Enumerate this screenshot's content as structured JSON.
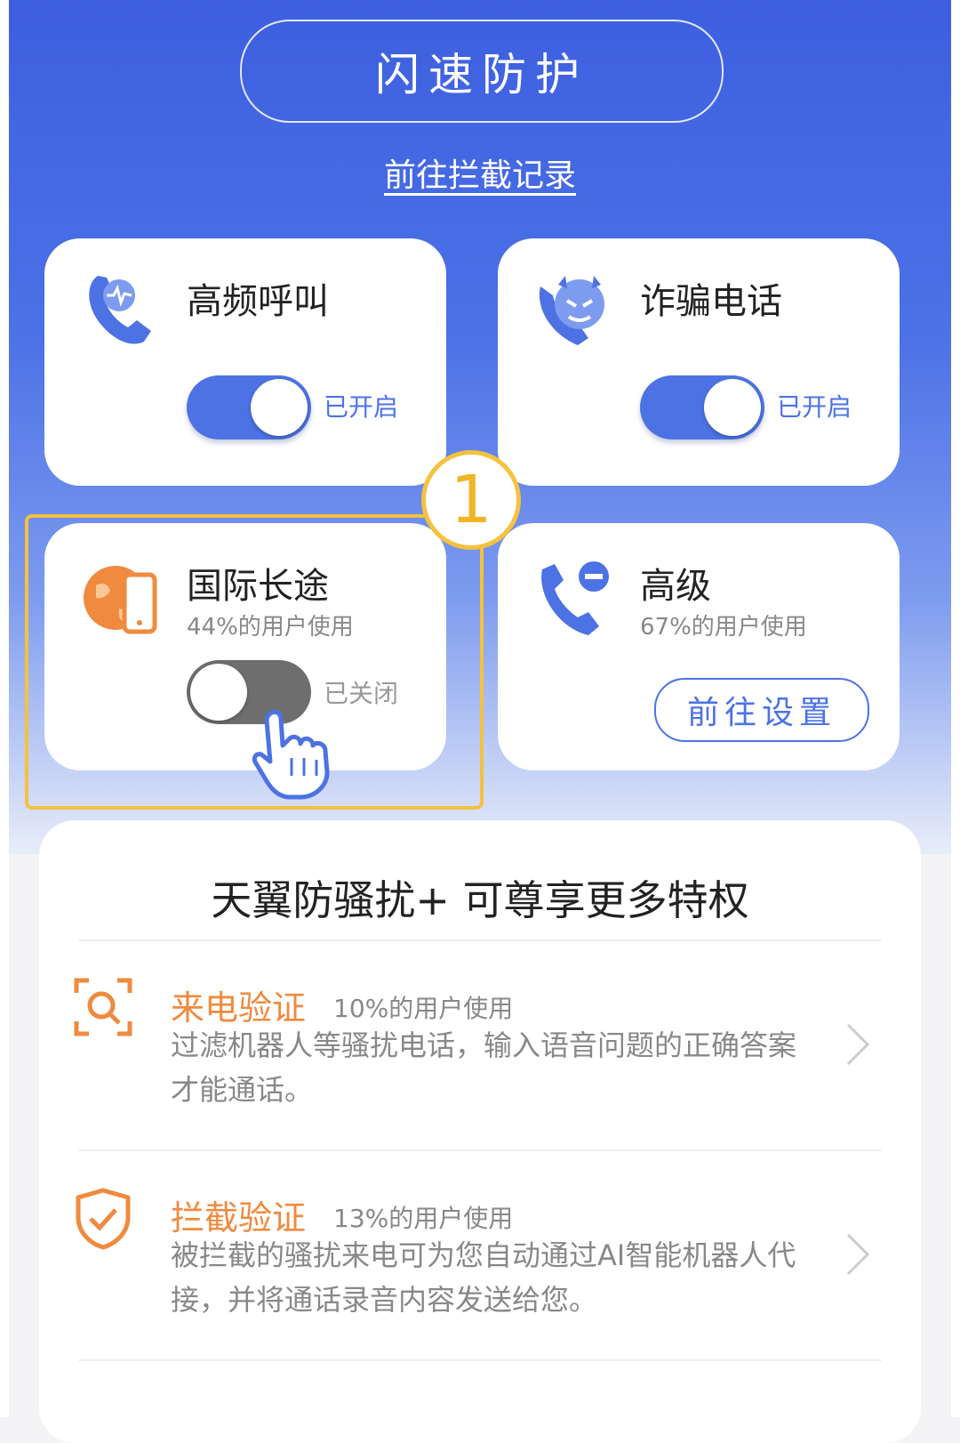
{
  "top": {
    "protect_button": "闪速防护",
    "record_link": "前往拦截记录"
  },
  "cards": [
    {
      "title": "高频呼叫",
      "state": "已开启",
      "enabled": true,
      "icon": "phone-heartbeat-icon"
    },
    {
      "title": "诈骗电话",
      "state": "已开启",
      "enabled": true,
      "icon": "devil-phone-icon"
    },
    {
      "title": "国际长途",
      "subtitle": "44%的用户使用",
      "state": "已关闭",
      "enabled": false,
      "icon": "globe-phone-icon"
    },
    {
      "title": "高级",
      "subtitle": "67%的用户使用",
      "button": "前往设置",
      "icon": "phone-minus-icon"
    }
  ],
  "step_badge": "1",
  "premium": {
    "title": "天翼防骚扰+ 可尊享更多特权",
    "features": [
      {
        "title": "来电验证",
        "usage": "10%的用户使用",
        "desc": "过滤机器人等骚扰电话，输入语音问题的正确答案才能通话。",
        "icon": "scan-search-icon"
      },
      {
        "title": "拦截验证",
        "usage": "13%的用户使用",
        "desc": "被拦截的骚扰来电可为您自动通过AI智能机器人代接，并将通话录音内容发送给您。",
        "icon": "shield-check-icon"
      }
    ]
  },
  "colors": {
    "primary": "#4c72e4",
    "accent": "#f08a3e",
    "highlight": "#f5c23e"
  }
}
